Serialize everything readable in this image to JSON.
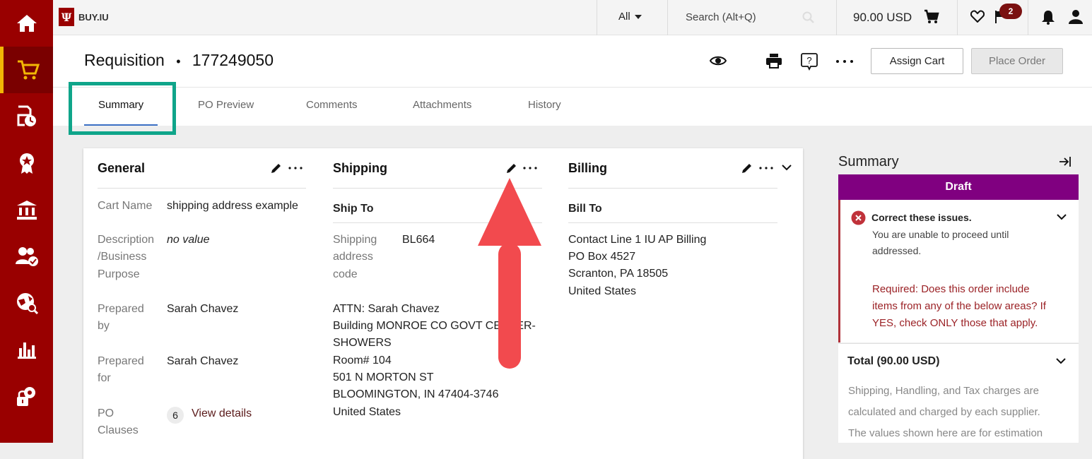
{
  "topbar": {
    "logo_letter": "Ψ",
    "logo_text": "BUY.IU",
    "search_scope": "All",
    "search_placeholder": "Search (Alt+Q)",
    "cart_total": "90.00 USD",
    "flag_count": "2"
  },
  "header": {
    "title": "Requisition",
    "separator": "•",
    "req_number": "177249050",
    "assign_cart": "Assign Cart",
    "place_order": "Place Order"
  },
  "tabs": [
    "Summary",
    "PO Preview",
    "Comments",
    "Attachments",
    "History"
  ],
  "general": {
    "heading": "General",
    "cart_name_label": "Cart Name",
    "cart_name_value": "shipping address example",
    "desc_label_1": "Description",
    "desc_label_2": "/Business",
    "desc_label_3": "Purpose",
    "desc_value": "no value",
    "prepared_by_label_1": "Prepared",
    "prepared_by_label_2": "by",
    "prepared_by_value": "Sarah Chavez",
    "prepared_for_label_1": "Prepared",
    "prepared_for_label_2": "for",
    "prepared_for_value": "Sarah Chavez",
    "po_clauses_label_1": "PO",
    "po_clauses_label_2": "Clauses",
    "po_clauses_count": "6",
    "view_details": "View details"
  },
  "shipping": {
    "heading": "Shipping",
    "ship_to": "Ship To",
    "code_label_1": "Shipping",
    "code_label_2": "address",
    "code_label_3": "code",
    "code_value": "BL664",
    "address_lines": [
      "ATTN: Sarah Chavez",
      "Building MONROE CO GOVT CENTER-",
      "SHOWERS",
      "Room# 104",
      "501 N MORTON ST",
      "BLOOMINGTON, IN 47404-3746",
      "United States"
    ]
  },
  "billing": {
    "heading": "Billing",
    "bill_to": "Bill To",
    "address_lines": [
      "Contact Line 1 IU AP Billing",
      "PO Box 4527",
      "Scranton, PA 18505",
      "United States"
    ]
  },
  "summary": {
    "title": "Summary",
    "status": "Draft",
    "issues_title": "Correct these issues.",
    "issues_text_1": "You are unable to proceed until",
    "issues_text_2": "addressed.",
    "required_1": "Required: Does this order include",
    "required_2": "items from any of the below areas? If",
    "required_3": "YES, check ONLY those that apply.",
    "total_label": "Total (90.00 USD)",
    "total_note_1": "Shipping, Handling, and Tax charges are",
    "total_note_2": "calculated and charged by each supplier.",
    "total_note_3": "The values shown here are for estimation"
  },
  "colors": {
    "nav_bg": "#990000",
    "active_accent": "#f2b705",
    "highlight_box": "#0fa58a",
    "draft_bg": "#800080",
    "arrow": "#f24a4e",
    "required_text": "#9b2226"
  }
}
